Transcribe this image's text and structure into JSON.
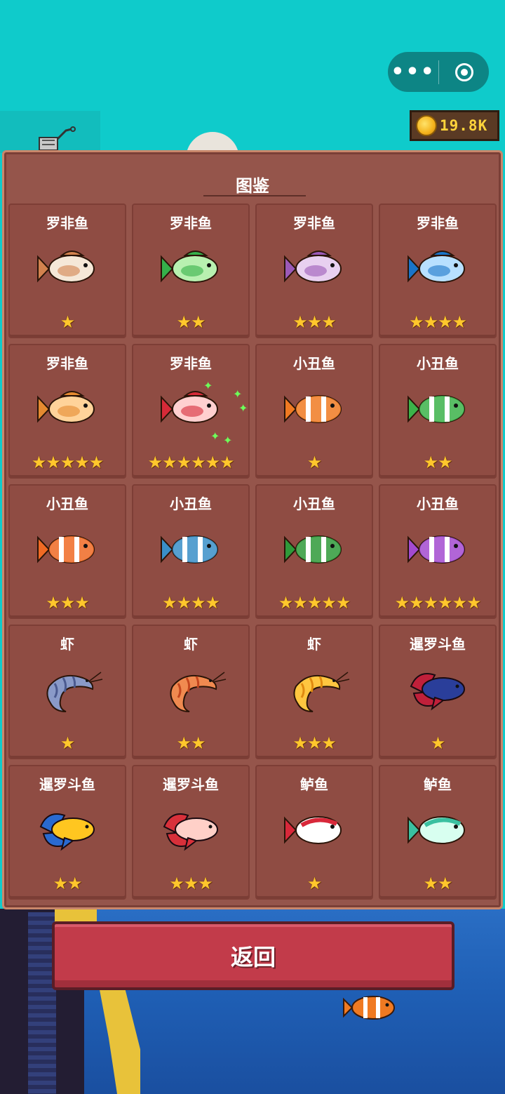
{
  "top_bar": {
    "more_label": "•••",
    "coins": "19.8K"
  },
  "panel": {
    "title": "图鉴",
    "cards": [
      {
        "name": "罗非鱼",
        "stars": 1,
        "icon": "tilapia-fish-icon",
        "colors": [
          "#f5e8d8",
          "#d2824e"
        ]
      },
      {
        "name": "罗非鱼",
        "stars": 2,
        "icon": "tilapia-fish-icon",
        "colors": [
          "#b8f0b0",
          "#35b04a"
        ]
      },
      {
        "name": "罗非鱼",
        "stars": 3,
        "icon": "tilapia-fish-icon",
        "colors": [
          "#e8d0f0",
          "#9b5ab8"
        ]
      },
      {
        "name": "罗非鱼",
        "stars": 4,
        "icon": "tilapia-fish-icon",
        "colors": [
          "#b8e0ff",
          "#1a74c8"
        ]
      },
      {
        "name": "罗非鱼",
        "stars": 5,
        "icon": "tilapia-fish-icon",
        "colors": [
          "#ffd39a",
          "#e58a30"
        ]
      },
      {
        "name": "罗非鱼",
        "stars": 6,
        "icon": "tilapia-fish-icon",
        "colors": [
          "#ffd0d0",
          "#d62a38"
        ]
      },
      {
        "name": "小丑鱼",
        "stars": 1,
        "icon": "clownfish-icon",
        "colors": [
          "#ffffff",
          "#f07a22"
        ]
      },
      {
        "name": "小丑鱼",
        "stars": 2,
        "icon": "clownfish-icon",
        "colors": [
          "#ffffff",
          "#3cb34a"
        ]
      },
      {
        "name": "小丑鱼",
        "stars": 3,
        "icon": "clownfish-icon",
        "colors": [
          "#ffffff",
          "#f06a24"
        ]
      },
      {
        "name": "小丑鱼",
        "stars": 4,
        "icon": "clownfish-icon",
        "colors": [
          "#ffffff",
          "#3a8fc8"
        ]
      },
      {
        "name": "小丑鱼",
        "stars": 5,
        "icon": "clownfish-icon",
        "colors": [
          "#ffffff",
          "#2f9a3a"
        ]
      },
      {
        "name": "小丑鱼",
        "stars": 6,
        "icon": "clownfish-icon",
        "colors": [
          "#ffffff",
          "#a34ad0"
        ]
      },
      {
        "name": "虾",
        "stars": 1,
        "icon": "shrimp-icon",
        "colors": [
          "#8a9ac8",
          "#4b5a90"
        ]
      },
      {
        "name": "虾",
        "stars": 2,
        "icon": "shrimp-icon",
        "colors": [
          "#f08a50",
          "#c4461e"
        ]
      },
      {
        "name": "虾",
        "stars": 3,
        "icon": "shrimp-icon",
        "colors": [
          "#ffc640",
          "#e08a10"
        ]
      },
      {
        "name": "暹罗斗鱼",
        "stars": 1,
        "icon": "betta-fish-icon",
        "colors": [
          "#2a3e9a",
          "#c0203a"
        ]
      },
      {
        "name": "暹罗斗鱼",
        "stars": 2,
        "icon": "betta-fish-icon",
        "colors": [
          "#ffc620",
          "#2a6ad0"
        ]
      },
      {
        "name": "暹罗斗鱼",
        "stars": 3,
        "icon": "betta-fish-icon",
        "colors": [
          "#ffd0c8",
          "#d8303a"
        ]
      },
      {
        "name": "鲈鱼",
        "stars": 1,
        "icon": "perch-fish-icon",
        "colors": [
          "#ffffff",
          "#d8283a"
        ]
      },
      {
        "name": "鲈鱼",
        "stars": 2,
        "icon": "perch-fish-icon",
        "colors": [
          "#d8fff0",
          "#3ac0a0"
        ]
      }
    ]
  },
  "back_button": {
    "label": "返回"
  },
  "colors": {
    "sky": "#0fcbcb",
    "panel": "#95554b",
    "card": "#8f4c43",
    "star": "#ffc72c",
    "back_button": "#c23b4a",
    "coin_text": "#ffd43b"
  }
}
